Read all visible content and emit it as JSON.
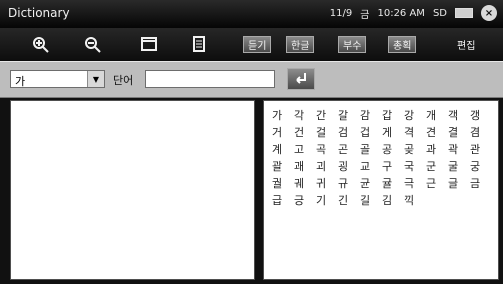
{
  "app": {
    "title": "Dictionary"
  },
  "status": {
    "date": "11/9",
    "day": "금",
    "time": "10:26 AM",
    "sd_label": "SD"
  },
  "toolbar": {
    "buttons": [
      "듣기",
      "한글",
      "부수",
      "총획",
      "편집"
    ]
  },
  "search": {
    "selected_value": "가",
    "word_label": "단어",
    "word_input_value": ""
  },
  "results": {
    "rows": [
      [
        "가",
        "각",
        "간",
        "갈",
        "감",
        "갑",
        "강",
        "개",
        "객",
        "갱"
      ],
      [
        "거",
        "건",
        "걸",
        "검",
        "겁",
        "게",
        "격",
        "견",
        "결",
        "겸"
      ],
      [
        "계",
        "고",
        "곡",
        "곤",
        "골",
        "공",
        "곶",
        "과",
        "곽",
        "관"
      ],
      [
        "괄",
        "괘",
        "괴",
        "굉",
        "교",
        "구",
        "국",
        "군",
        "굴",
        "궁"
      ],
      [
        "궐",
        "궤",
        "귀",
        "규",
        "균",
        "귤",
        "극",
        "근",
        "글",
        "금"
      ],
      [
        "급",
        "긍",
        "기",
        "긴",
        "길",
        "김",
        "끽"
      ]
    ]
  }
}
